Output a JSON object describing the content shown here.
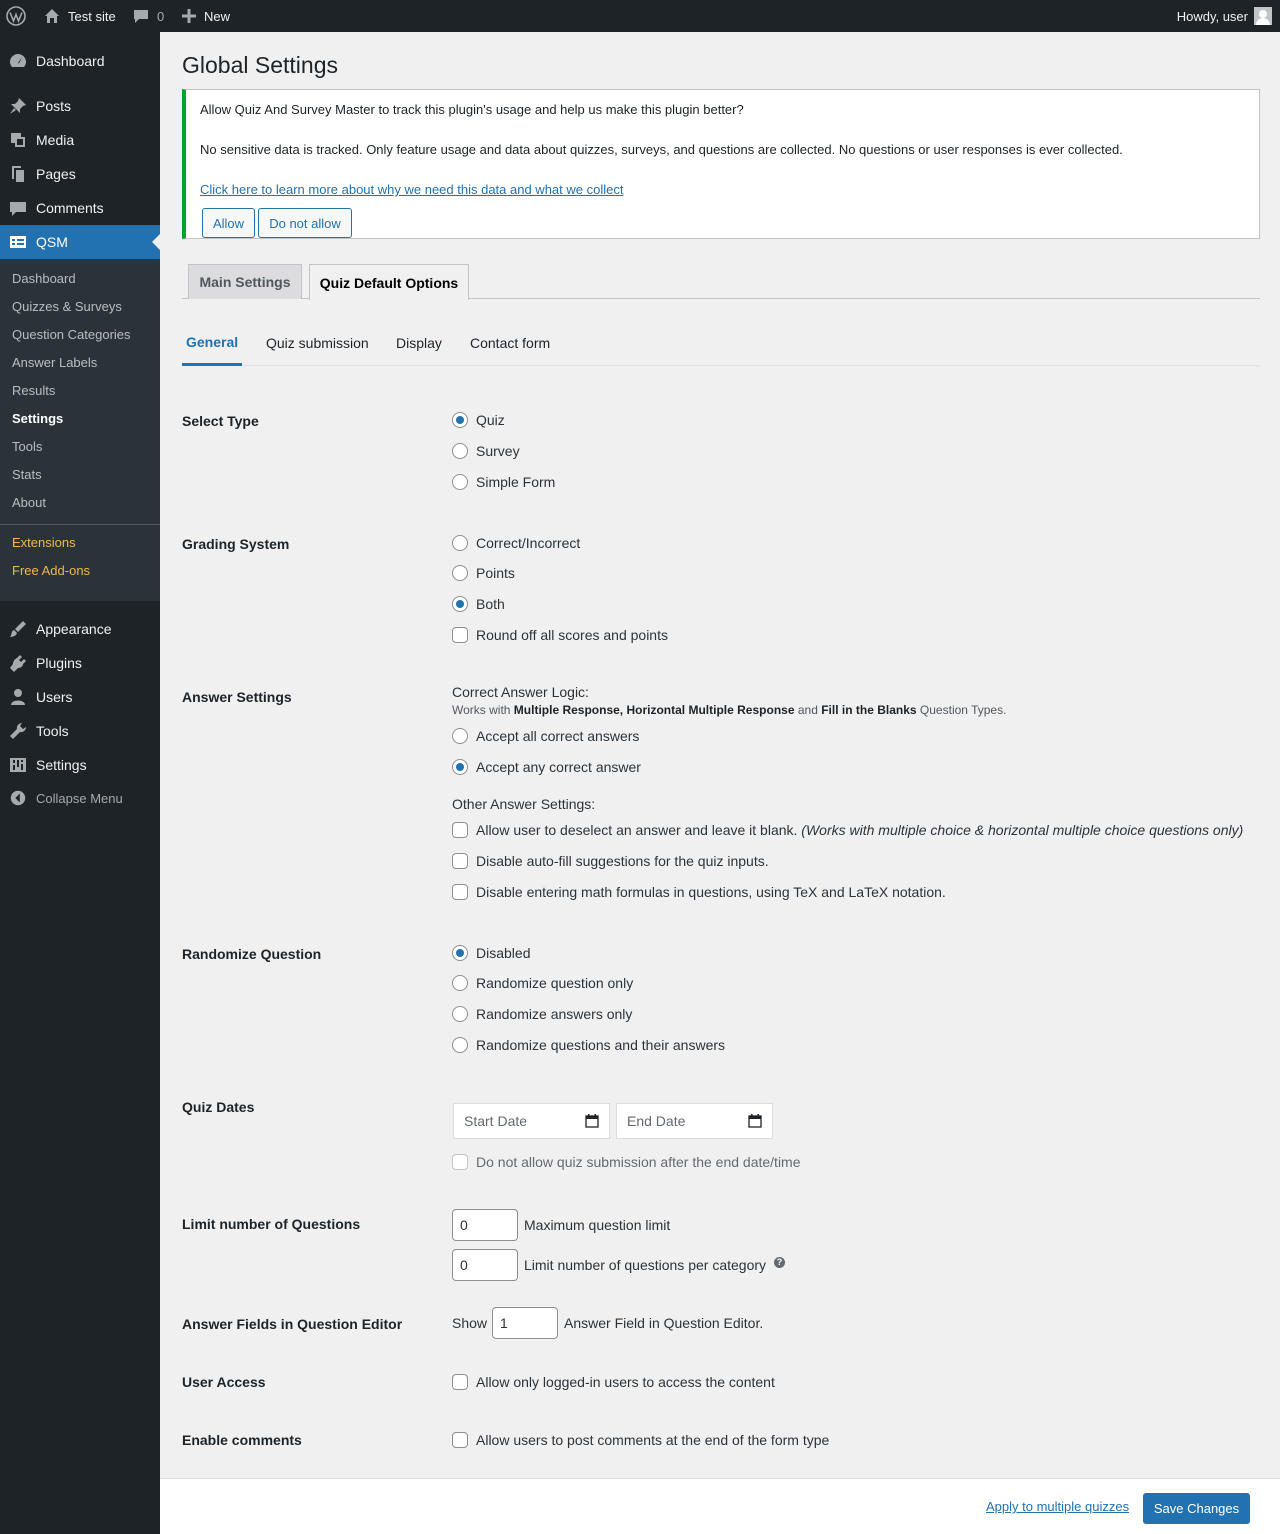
{
  "admin_bar": {
    "site_name": "Test site",
    "comments_count": "0",
    "new_label": "New",
    "howdy": "Howdy, user"
  },
  "sidebar": {
    "items": [
      {
        "label": "Dashboard",
        "icon": "dashboard-icon"
      },
      {
        "label": "Posts",
        "icon": "pin-icon"
      },
      {
        "label": "Media",
        "icon": "media-icon"
      },
      {
        "label": "Pages",
        "icon": "pages-icon"
      },
      {
        "label": "Comments",
        "icon": "comment-icon"
      },
      {
        "label": "QSM",
        "icon": "qsm-icon"
      },
      {
        "label": "Appearance",
        "icon": "brush-icon"
      },
      {
        "label": "Plugins",
        "icon": "plugin-icon"
      },
      {
        "label": "Users",
        "icon": "user-icon"
      },
      {
        "label": "Tools",
        "icon": "wrench-icon"
      },
      {
        "label": "Settings",
        "icon": "settings-icon"
      },
      {
        "label": "Collapse Menu",
        "icon": "collapse-icon"
      }
    ],
    "submenu": [
      "Dashboard",
      "Quizzes & Surveys",
      "Question Categories",
      "Answer Labels",
      "Results",
      "Settings",
      "Tools",
      "Stats",
      "About",
      "Extensions",
      "Free Add-ons"
    ]
  },
  "page": {
    "title": "Global Settings"
  },
  "notice": {
    "line1": "Allow Quiz And Survey Master to track this plugin's usage and help us make this plugin better?",
    "line2": "No sensitive data is tracked. Only feature usage and data about quizzes, surveys, and questions are collected. No questions or user responses is ever collected.",
    "link": "Click here to learn more about why we need this data and what we collect",
    "allow": "Allow",
    "deny": "Do not allow"
  },
  "tabs": [
    "Main Settings",
    "Quiz Default Options"
  ],
  "subtabs": [
    "General",
    "Quiz submission",
    "Display",
    "Contact form"
  ],
  "settings": {
    "select_type": {
      "label": "Select Type",
      "options": [
        "Quiz",
        "Survey",
        "Simple Form"
      ],
      "selected": "Quiz"
    },
    "grading": {
      "label": "Grading System",
      "options": [
        "Correct/Incorrect",
        "Points",
        "Both"
      ],
      "selected": "Both",
      "round_off": "Round off all scores and points"
    },
    "answer": {
      "label": "Answer Settings",
      "logic_title": "Correct Answer Logic:",
      "works_with_prefix": "Works with",
      "works_with_types": "Multiple Response, Horizontal Multiple Response",
      "works_with_and": "and",
      "works_with_type2": "Fill in the Blanks",
      "works_with_suffix": "Question Types.",
      "options": [
        "Accept all correct answers",
        "Accept any correct answer"
      ],
      "selected": "Accept any correct answer",
      "other_title": "Other Answer Settings:",
      "deselect": "Allow user to deselect an answer and leave it blank.",
      "deselect_note": "(Works with multiple choice & horizontal multiple choice questions only)",
      "autofill": "Disable auto-fill suggestions for the quiz inputs.",
      "math": "Disable entering math formulas in questions, using TeX and LaTeX notation."
    },
    "randomize": {
      "label": "Randomize Question",
      "options": [
        "Disabled",
        "Randomize question only",
        "Randomize answers only",
        "Randomize questions and their answers"
      ],
      "selected": "Disabled"
    },
    "dates": {
      "label": "Quiz Dates",
      "start_placeholder": "Start Date",
      "end_placeholder": "End Date",
      "no_submit": "Do not allow quiz submission after the end date/time"
    },
    "limit": {
      "label": "Limit number of Questions",
      "max_value": "0",
      "max_label": "Maximum question limit",
      "per_cat_value": "0",
      "per_cat_label": "Limit number of questions per category",
      "help": "?"
    },
    "answer_fields": {
      "label": "Answer Fields in Question Editor",
      "show": "Show",
      "value": "1",
      "suffix": "Answer Field in Question Editor."
    },
    "user_access": {
      "label": "User Access",
      "option": "Allow only logged-in users to access the content"
    },
    "comments": {
      "label": "Enable comments",
      "option": "Allow users to post comments at the end of the form type"
    }
  },
  "footer": {
    "apply": "Apply to multiple quizzes",
    "save": "Save Changes"
  },
  "colors": {
    "accent": "#2271b1",
    "sidebar": "#1d2327",
    "notice_border": "#00a32a",
    "addon": "#f0b849"
  }
}
